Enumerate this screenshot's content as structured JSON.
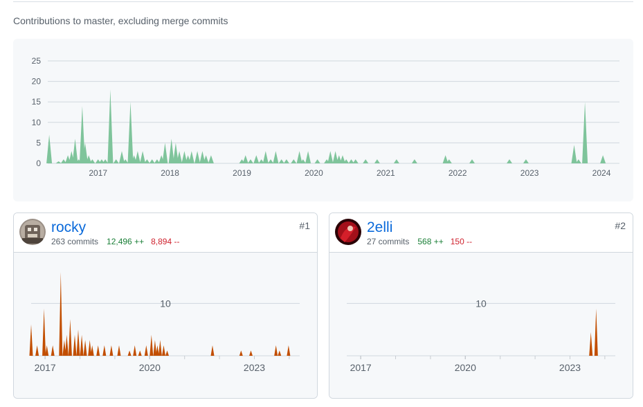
{
  "subtitle": "Contributions to master, excluding merge commits",
  "colors": {
    "overall": "#7fc49b",
    "contributor": "#c24e00",
    "link": "#0969da",
    "add": "#1a7f37",
    "del": "#cf222e"
  },
  "chart_data": [
    {
      "type": "area",
      "title": "",
      "xlabel": "",
      "ylabel": "",
      "ylim": [
        0,
        25
      ],
      "yticks": [
        0,
        5,
        10,
        15,
        20,
        25
      ],
      "xlim": [
        2016.3,
        2024.25
      ],
      "xticks": [
        "2017",
        "2018",
        "2019",
        "2020",
        "2021",
        "2022",
        "2023",
        "2024"
      ],
      "grid": true,
      "series": [
        {
          "x": [
            2016.32,
            2016.45,
            2016.52,
            2016.58,
            2016.63,
            2016.68,
            2016.73,
            2016.78,
            2016.82,
            2016.87,
            2016.92,
            2017.0,
            2017.05,
            2017.1,
            2017.17,
            2017.25,
            2017.33,
            2017.38,
            2017.45,
            2017.5,
            2017.55,
            2017.62,
            2017.68,
            2017.75,
            2017.82,
            2017.88,
            2017.93,
            2018.02,
            2018.08,
            2018.13,
            2018.2,
            2018.25,
            2018.3,
            2018.38,
            2018.45,
            2018.5,
            2018.57,
            2019.0,
            2019.05,
            2019.12,
            2019.2,
            2019.27,
            2019.33,
            2019.4,
            2019.47,
            2019.55,
            2019.62,
            2019.72,
            2019.8,
            2019.85,
            2019.92,
            2020.05,
            2020.18,
            2020.23,
            2020.3,
            2020.35,
            2020.4,
            2020.45,
            2020.52,
            2020.58,
            2020.72,
            2020.88,
            2021.15,
            2021.4,
            2021.83,
            2021.88,
            2022.2,
            2022.72,
            2022.95,
            2023.62,
            2023.68,
            2023.77,
            2024.02
          ],
          "y": [
            7,
            0.5,
            1,
            2,
            3,
            6,
            1,
            14,
            5,
            2,
            1,
            1,
            1,
            1,
            18,
            1,
            3,
            1,
            15,
            2,
            3,
            3,
            1,
            1,
            1,
            2,
            5,
            6,
            5,
            3,
            3,
            2,
            3,
            3,
            3,
            2,
            2,
            1,
            2,
            1,
            2,
            1,
            3,
            1,
            3,
            1,
            1,
            1,
            3,
            1,
            3,
            1,
            1,
            3,
            3,
            2,
            2,
            1,
            1,
            1,
            1,
            1,
            1,
            1,
            2,
            1,
            1,
            1,
            1,
            4.5,
            1,
            15,
            2
          ]
        }
      ]
    },
    {
      "type": "area",
      "title": "",
      "series_owner": "rocky",
      "xlim": [
        2016.6,
        2024.3
      ],
      "ylim": [
        0,
        16
      ],
      "yticks": [
        10
      ],
      "xticks": [
        "2017",
        "2020",
        "2023"
      ],
      "grid": true,
      "series": [
        {
          "x": [
            2016.6,
            2016.77,
            2016.97,
            2017.05,
            2017.22,
            2017.45,
            2017.55,
            2017.62,
            2017.72,
            2017.85,
            2017.95,
            2018.05,
            2018.15,
            2018.28,
            2018.35,
            2018.52,
            2018.7,
            2018.9,
            2019.12,
            2019.42,
            2019.57,
            2019.72,
            2019.9,
            2020.05,
            2020.15,
            2020.22,
            2020.3,
            2020.4,
            2020.5,
            2021.8,
            2022.62,
            2022.9,
            2023.62,
            2023.72,
            2023.98
          ],
          "y": [
            6,
            2,
            9,
            2,
            2,
            16,
            3,
            4,
            7,
            4,
            5,
            4,
            3,
            3,
            2,
            2,
            2,
            2,
            2,
            1,
            2,
            1,
            2,
            4,
            3,
            2,
            3,
            2,
            1,
            2,
            1,
            1,
            2,
            1,
            2
          ]
        }
      ]
    },
    {
      "type": "area",
      "title": "",
      "series_owner": "2elli",
      "xlim": [
        2016.6,
        2024.3
      ],
      "ylim": [
        0,
        16
      ],
      "yticks": [
        10
      ],
      "xticks": [
        "2017",
        "2020",
        "2023"
      ],
      "grid": true,
      "series": [
        {
          "x": [
            2023.6,
            2023.75
          ],
          "y": [
            4.5,
            9
          ]
        }
      ]
    }
  ],
  "contributors": [
    {
      "login": "rocky",
      "commits": "263 commits",
      "additions": "12,496 ++",
      "deletions": "8,894 --",
      "rank": "#1"
    },
    {
      "login": "2elli",
      "commits": "27 commits",
      "additions": "568 ++",
      "deletions": "150 --",
      "rank": "#2"
    }
  ]
}
